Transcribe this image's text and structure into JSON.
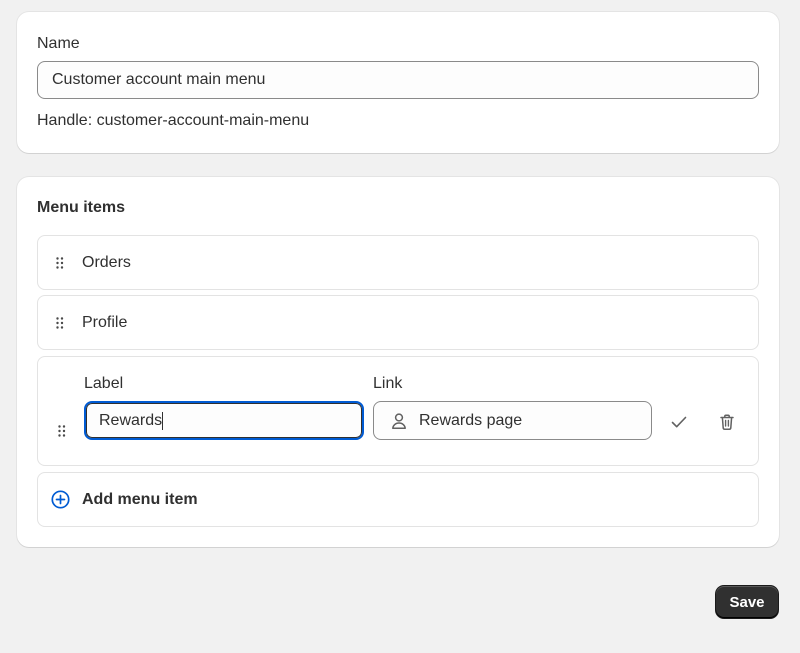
{
  "name_card": {
    "label": "Name",
    "value": "Customer account main menu",
    "handle": "Handle: customer-account-main-menu"
  },
  "menu_card": {
    "title": "Menu items",
    "items": [
      {
        "label": "Orders"
      },
      {
        "label": "Profile"
      }
    ],
    "editing": {
      "label_heading": "Label",
      "label_value": "Rewards",
      "link_heading": "Link",
      "link_value": "Rewards page"
    },
    "add_label": "Add menu item"
  },
  "footer": {
    "save_label": "Save"
  },
  "colors": {
    "accent": "#005bd3",
    "primary_button": "#303030",
    "page_bg": "#f1f1f1"
  }
}
